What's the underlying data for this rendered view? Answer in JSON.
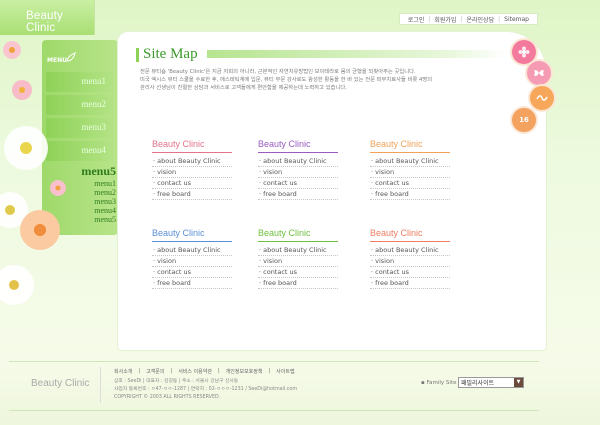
{
  "brand": {
    "logo": "Beauty Clinic"
  },
  "topnav": {
    "items": [
      "로그인",
      "회원가입",
      "온라인상담",
      "Sitemap"
    ]
  },
  "sidebar": {
    "tag": "MENU",
    "items": [
      "menu1",
      "menu2",
      "menu3",
      "menu4"
    ],
    "active": "menu5",
    "subitems": [
      "menu1",
      "menu2",
      "menu3",
      "menu4",
      "menu5"
    ]
  },
  "main": {
    "title": "Site Map",
    "intro": [
      "전문 뷰티숍 'Beauty Clinic'은 지금 저희의 아니라, 근본적인 자연치유방법인 보이테라로 몸의 균형을 되찾아주는 곳입니다.",
      "미국 엑시스 뷰티 스쿨을 수료한 후, 에스테틱계에 입문, 뷰티 부문 강사로도 왕성한 활동을 한 바 있는 전문 피부치료사들 비롯 4명의",
      "관리사 선생님이 친절한 상담과 서비스로 고객들에게 편안함을 제공하는데 노력하고 있습니다."
    ],
    "groups": [
      {
        "title": "Beauty Clinic",
        "color": "#e5738a",
        "items": [
          "about Beauty Clinic",
          "vision",
          "contact us",
          "free board"
        ]
      },
      {
        "title": "Beauty Clinic",
        "color": "#9a5cc1",
        "items": [
          "about Beauty Clinic",
          "vision",
          "contact us",
          "free board"
        ]
      },
      {
        "title": "Beauty Clinic",
        "color": "#f0a25a",
        "items": [
          "about Beauty Clinic",
          "vision",
          "contact us",
          "free board"
        ]
      },
      {
        "title": "Beauty Clinic",
        "color": "#5b8fd6",
        "items": [
          "about Beauty Clinic",
          "vision",
          "contact us",
          "free board"
        ]
      },
      {
        "title": "Beauty Clinic",
        "color": "#6fbf3e",
        "items": [
          "about Beauty Clinic",
          "vision",
          "contact us",
          "free board"
        ]
      },
      {
        "title": "Beauty Clinic",
        "color": "#ee7d62",
        "items": [
          "about Beauty Clinic",
          "vision",
          "contact us",
          "free board"
        ]
      }
    ]
  },
  "side_buttons": [
    {
      "icon": "flower-icon",
      "color": "#f37a9c"
    },
    {
      "icon": "butterfly-icon",
      "color": "#f59bb4"
    },
    {
      "icon": "wave-icon",
      "color": "#f7a75a"
    },
    {
      "icon": "age-badge-icon",
      "color": "#f4a25f",
      "label": "16"
    }
  ],
  "footer": {
    "logo": "Beauty Clinic",
    "links": [
      "회사소개",
      "|",
      "고객문의",
      "|",
      "서비스 이용약관",
      "|",
      "개인정보보호정책",
      "|",
      "사이트맵"
    ],
    "info": [
      "상호 : SeeDi  |  대표자 : 김길동  |  주소 : 서울시 강남구 신사동",
      "사업자 등록번호 : ㅇ47-ㅇㅇ-1287  |  연락처 : 02-ㅇㅇㅇ-1231  /  SeeDi@hotmail.com",
      "COPYRIGHT © 2003 ALL RIGHTS RESERVED."
    ],
    "family_label": "▪ Family Site",
    "family_value": "패밀리사이트"
  }
}
